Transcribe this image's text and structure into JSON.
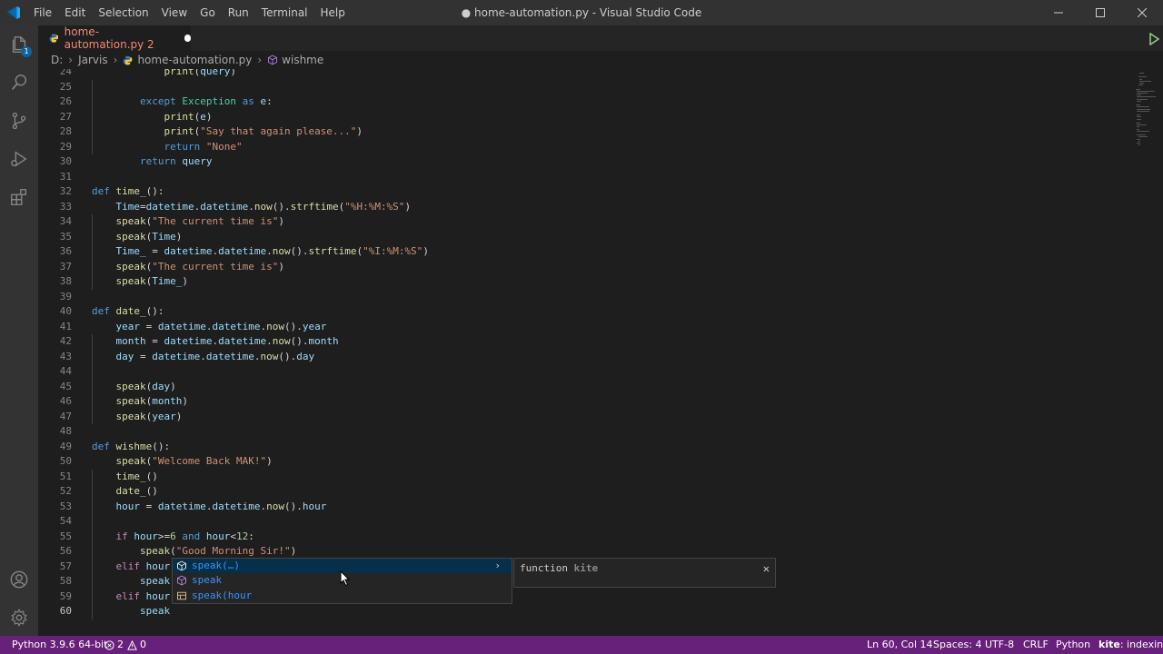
{
  "window": {
    "title": "● home-automation.py - Visual Studio Code",
    "menu": [
      "File",
      "Edit",
      "Selection",
      "View",
      "Go",
      "Run",
      "Terminal",
      "Help"
    ]
  },
  "activity": {
    "explorer_badge": "1"
  },
  "tab": {
    "label": "home-automation.py 2"
  },
  "breadcrumb": {
    "drive": "D:",
    "folder": "Jarvis",
    "file": "home-automation.py",
    "symbol": "wishme"
  },
  "lines": [
    {
      "n": "24",
      "text": "            print(query)"
    },
    {
      "n": "25",
      "text": ""
    },
    {
      "n": "26",
      "text": "        except Exception as e:"
    },
    {
      "n": "27",
      "text": "            print(e)"
    },
    {
      "n": "28",
      "text": "            print(\"Say that again please...\")"
    },
    {
      "n": "29",
      "text": "            return \"None\""
    },
    {
      "n": "30",
      "text": "        return query"
    },
    {
      "n": "31",
      "text": ""
    },
    {
      "n": "32",
      "text": "def time_():"
    },
    {
      "n": "33",
      "text": "    Time=datetime.datetime.now().strftime(\"%H:%M:%S\")"
    },
    {
      "n": "34",
      "text": "    speak(\"The current time is\")"
    },
    {
      "n": "35",
      "text": "    speak(Time)"
    },
    {
      "n": "36",
      "text": "    Time_ = datetime.datetime.now().strftime(\"%I:%M:%S\")"
    },
    {
      "n": "37",
      "text": "    speak(\"The current time is\")"
    },
    {
      "n": "38",
      "text": "    speak(Time_)"
    },
    {
      "n": "39",
      "text": ""
    },
    {
      "n": "40",
      "text": "def date_():"
    },
    {
      "n": "41",
      "text": "    year = datetime.datetime.now().year"
    },
    {
      "n": "42",
      "text": "    month = datetime.datetime.now().month"
    },
    {
      "n": "43",
      "text": "    day = datetime.datetime.now().day"
    },
    {
      "n": "44",
      "text": ""
    },
    {
      "n": "45",
      "text": "    speak(day)"
    },
    {
      "n": "46",
      "text": "    speak(month)"
    },
    {
      "n": "47",
      "text": "    speak(year)"
    },
    {
      "n": "48",
      "text": ""
    },
    {
      "n": "49",
      "text": "def wishme():"
    },
    {
      "n": "50",
      "text": "    speak(\"Welcome Back MAK!\")"
    },
    {
      "n": "51",
      "text": "    time_()"
    },
    {
      "n": "52",
      "text": "    date_()"
    },
    {
      "n": "53",
      "text": "    hour = datetime.datetime.now().hour"
    },
    {
      "n": "54",
      "text": ""
    },
    {
      "n": "55",
      "text": "    if hour>=6 and hour<12:"
    },
    {
      "n": "56",
      "text": "        speak(\"Good Morning Sir!\")"
    },
    {
      "n": "57",
      "text": "    elif hour"
    },
    {
      "n": "58",
      "text": "        speak"
    },
    {
      "n": "59",
      "text": "    elif hour"
    },
    {
      "n": "60",
      "text": "        speak"
    }
  ],
  "suggest": {
    "items": [
      {
        "label": "speak(…)",
        "icon": "cube-icon"
      },
      {
        "label": "speak",
        "icon": "cube-icon"
      },
      {
        "label": "speak(hour",
        "icon": "snippet-icon"
      }
    ],
    "details": {
      "kind": "function",
      "source": "kite"
    }
  },
  "status": {
    "python": "Python 3.9.6 64-bit",
    "errors": "2",
    "warnings": "0",
    "position": "Ln 60, Col 14",
    "spaces": "Spaces: 4",
    "encoding": "UTF-8",
    "eol": "CRLF",
    "language": "Python",
    "kite_brand": "kite",
    "kite_status": ": indexing"
  },
  "colors": {
    "statusbar": "#68217a",
    "accent": "#007acc",
    "tab_modified": "#f48771"
  }
}
